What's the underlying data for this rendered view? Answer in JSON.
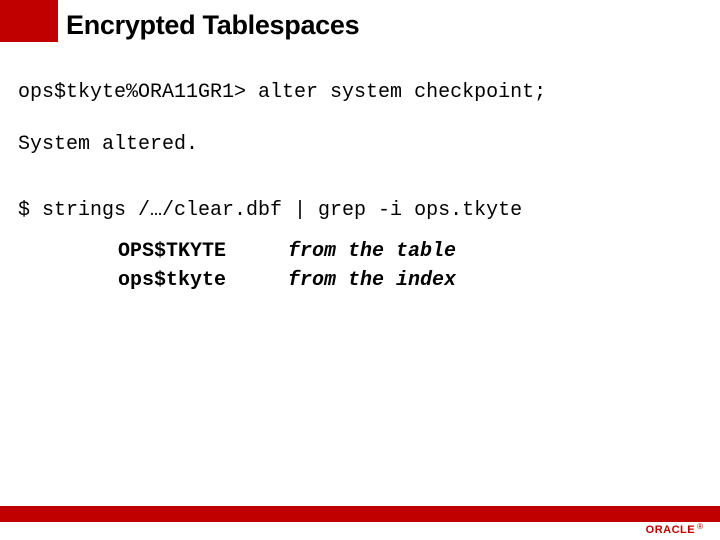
{
  "title": "Encrypted Tablespaces",
  "lines": {
    "prompt": "ops$tkyte%ORA11GR1> alter system checkpoint;",
    "result": "System altered.",
    "cmd": "$ strings /…/clear.dbf | grep -i ops.tkyte"
  },
  "rows": [
    {
      "left": "OPS$TKYTE",
      "right": "from the table"
    },
    {
      "left": "ops$tkyte",
      "right": "from the index"
    }
  ],
  "logo": {
    "word": "ORACLE",
    "reg": "®"
  }
}
